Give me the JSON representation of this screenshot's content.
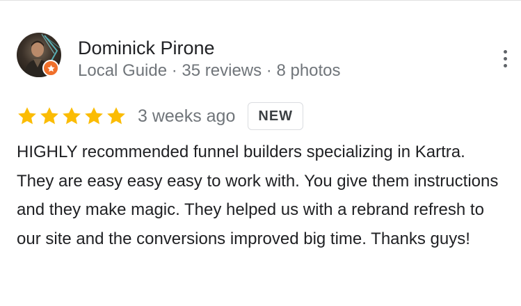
{
  "reviewer": {
    "name": "Dominick Pirone",
    "meta": "Local Guide · 35 reviews · 8 photos",
    "avatar_icon": "profile-photo",
    "badge_icon": "local-guide-star-icon",
    "badge_color": "#f06f2a"
  },
  "menu": {
    "icon": "more-vert-icon"
  },
  "review": {
    "rating": 5,
    "rating_max": 5,
    "star_color": "#fbbc04",
    "time_ago": "3 weeks ago",
    "badge": "NEW",
    "text": "HIGHLY recommended funnel builders specializing in Kartra. They are easy easy easy to work with. You give them instructions and they make magic. They helped us with a rebrand refresh to our site and the conversions improved big time. Thanks guys!"
  }
}
